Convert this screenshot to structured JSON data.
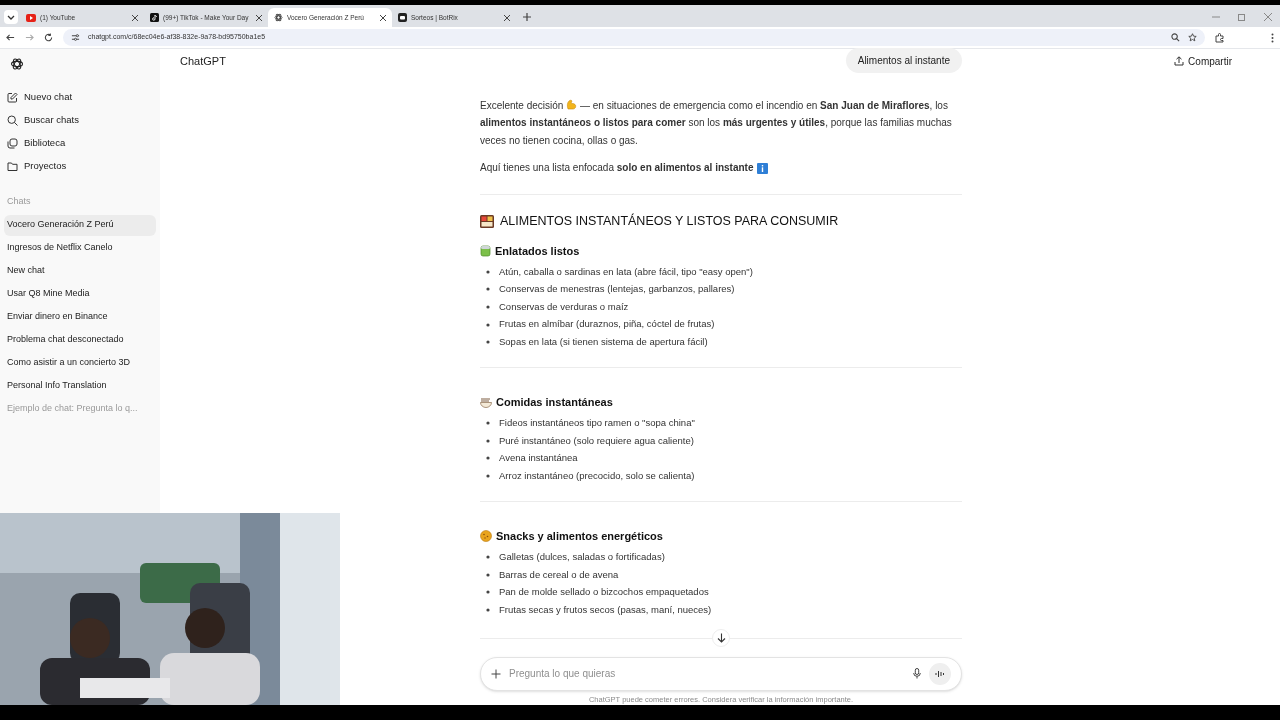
{
  "browser": {
    "tabs": [
      {
        "title": "(1) YouTube",
        "kind": "youtube",
        "selected": false
      },
      {
        "title": "(99+) TikTok - Make Your Day",
        "kind": "tiktok",
        "selected": false
      },
      {
        "title": "Vocero Generación Z Perú",
        "kind": "chatgpt",
        "selected": true
      },
      {
        "title": "Sorteos | BotRix",
        "kind": "botrix",
        "selected": false
      }
    ],
    "url": "chatgpt.com/c/68ec04e6-af38-832e-9a78-bd95750ba1e5"
  },
  "sidebar": {
    "nav_items": [
      {
        "label": "Nuevo chat",
        "kind": "edit"
      },
      {
        "label": "Buscar chats",
        "kind": "search"
      },
      {
        "label": "Biblioteca",
        "kind": "library"
      },
      {
        "label": "Proyectos",
        "kind": "folder"
      }
    ],
    "section_label": "Chats",
    "chats": [
      {
        "title": "Vocero Generación Z Perú",
        "selected": true,
        "dimmed": false
      },
      {
        "title": "Ingresos de Netflix Canelo",
        "selected": false,
        "dimmed": false
      },
      {
        "title": "New chat",
        "selected": false,
        "dimmed": false
      },
      {
        "title": "Usar Q8 Mine Media",
        "selected": false,
        "dimmed": false
      },
      {
        "title": "Enviar dinero en Binance",
        "selected": false,
        "dimmed": false
      },
      {
        "title": "Problema chat desconectado",
        "selected": false,
        "dimmed": false
      },
      {
        "title": "Como asistir a un concierto 3D",
        "selected": false,
        "dimmed": false
      },
      {
        "title": "Personal Info Translation",
        "selected": false,
        "dimmed": false
      },
      {
        "title": "Ejemplo de chat: Pregunta lo q...",
        "selected": false,
        "dimmed": true
      }
    ]
  },
  "header": {
    "app_title": "ChatGPT",
    "user_message": "Alimentos al instante",
    "share": "Compartir"
  },
  "answer": {
    "intro_before_icon": "Excelente decisión",
    "intro": "— en situaciones de emergencia como el incendio en **San Juan de Miraflores**, los **alimentos instantáneos o listos para comer** son los **más urgentes y útiles**, porque las familias muchas veces no tienen cocina, ollas o gas.",
    "lead": "Aquí tienes una lista enfocada **solo en alimentos al instante**",
    "title": "ALIMENTOS INSTANTÁNEOS Y LISTOS PARA CONSUMIR",
    "sections": [
      {
        "heading": "Enlatados listos",
        "kind": "can",
        "items": [
          "Atún, caballa o sardinas en lata (abre fácil, tipo \"easy open\")",
          "Conservas de menestras (lentejas, garbanzos, pallares)",
          "Conservas de verduras o maíz",
          "Frutas en almíbar (duraznos, piña, cóctel de frutas)",
          "Sopas en lata (si tienen sistema de apertura fácil)"
        ]
      },
      {
        "heading": "Comidas instantáneas",
        "kind": "bowl",
        "items": [
          "Fideos instantáneos tipo ramen o \"sopa china\"",
          "Puré instantáneo (solo requiere agua caliente)",
          "Avena instantánea",
          "Arroz instantáneo (precocido, solo se calienta)"
        ]
      },
      {
        "heading": "Snacks y alimentos energéticos",
        "kind": "cookie",
        "items": [
          "Galletas (dulces, saladas o fortificadas)",
          "Barras de cereal o de avena",
          "Pan de molde sellado o bizcochos empaquetados",
          "Frutas secas y frutos secos (pasas, maní, nueces)"
        ]
      }
    ]
  },
  "composer": {
    "placeholder": "Pregunta lo que quieras"
  },
  "disclaimer": "ChatGPT puede cometer errores. Considera verificar la información importante."
}
